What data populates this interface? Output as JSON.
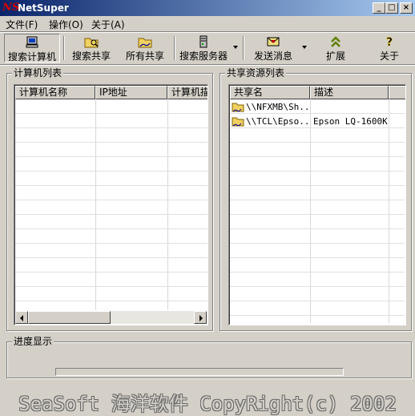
{
  "window": {
    "title": "NetSuper",
    "icon": "netsuper-logo-icon"
  },
  "titlebar": {
    "minimize_glyph": "_",
    "maximize_glyph": "□",
    "close_glyph": "×"
  },
  "menu": [
    {
      "label": "文件(F)"
    },
    {
      "label": "操作(O)"
    },
    {
      "label": "关于(A)"
    }
  ],
  "toolbar": {
    "search_computer": "搜索计算机",
    "search_share": "搜索共享",
    "all_share": "所有共享",
    "search_server": "搜索服务器",
    "send_message": "发送消息",
    "expand": "扩展",
    "about": "关于"
  },
  "computers": {
    "title": "计算机列表",
    "columns": [
      "计算机名称",
      "IP地址",
      "计算机描述"
    ],
    "rows": []
  },
  "shares": {
    "title": "共享资源列表",
    "columns": [
      "共享名",
      "描述"
    ],
    "rows": [
      {
        "name": "\\\\NFXMB\\Sh...",
        "desc": ""
      },
      {
        "name": "\\\\TCL\\Epso...",
        "desc": "Epson LQ-1600K"
      }
    ]
  },
  "progress": {
    "title": "进度显示",
    "value": 0
  },
  "footer": {
    "text": "SeaSoft 海洋软件 CopyRight(c) 2002"
  },
  "colors": {
    "titlebar_start": "#0a246a",
    "titlebar_end": "#a6caf0",
    "face": "#d4d0c8"
  }
}
